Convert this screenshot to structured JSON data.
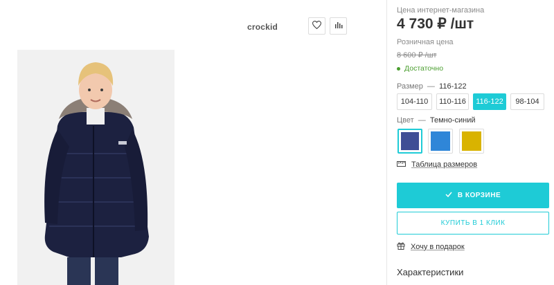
{
  "header": {
    "brand": "crockid",
    "wishlist_icon": "heart-icon",
    "compare_icon": "bar-chart-icon"
  },
  "product": {
    "image_alt": "Boy in dark navy winter parka with fur-trimmed hood"
  },
  "pricing": {
    "online_label": "Цена интернет-магазина",
    "online_price": "4 730 ₽ /шт",
    "retail_label": "Розничная цена",
    "retail_price": "8 600 ₽ /шт",
    "stock_status": "Достаточно"
  },
  "size": {
    "label": "Размер",
    "selected": "116-122",
    "options": [
      "104-110",
      "110-116",
      "116-122",
      "98-104"
    ]
  },
  "color": {
    "label": "Цвет",
    "selected": "Темно-синий",
    "swatches": [
      {
        "name": "Темно-синий",
        "hex": "#3f4e95"
      },
      {
        "name": "blue",
        "hex": "#2f86d8"
      },
      {
        "name": "yellow",
        "hex": "#d9b300"
      }
    ]
  },
  "size_chart_link": "Таблица размеров",
  "actions": {
    "in_cart": "В КОРЗИНЕ",
    "buy_one_click": "КУПИТЬ В 1 КЛИК",
    "gift_link": "Хочу в подарок"
  },
  "section": {
    "characteristics": "Характеристики"
  },
  "colors": {
    "accent": "#1ecbd6",
    "stock_green": "#4a9e2f"
  }
}
